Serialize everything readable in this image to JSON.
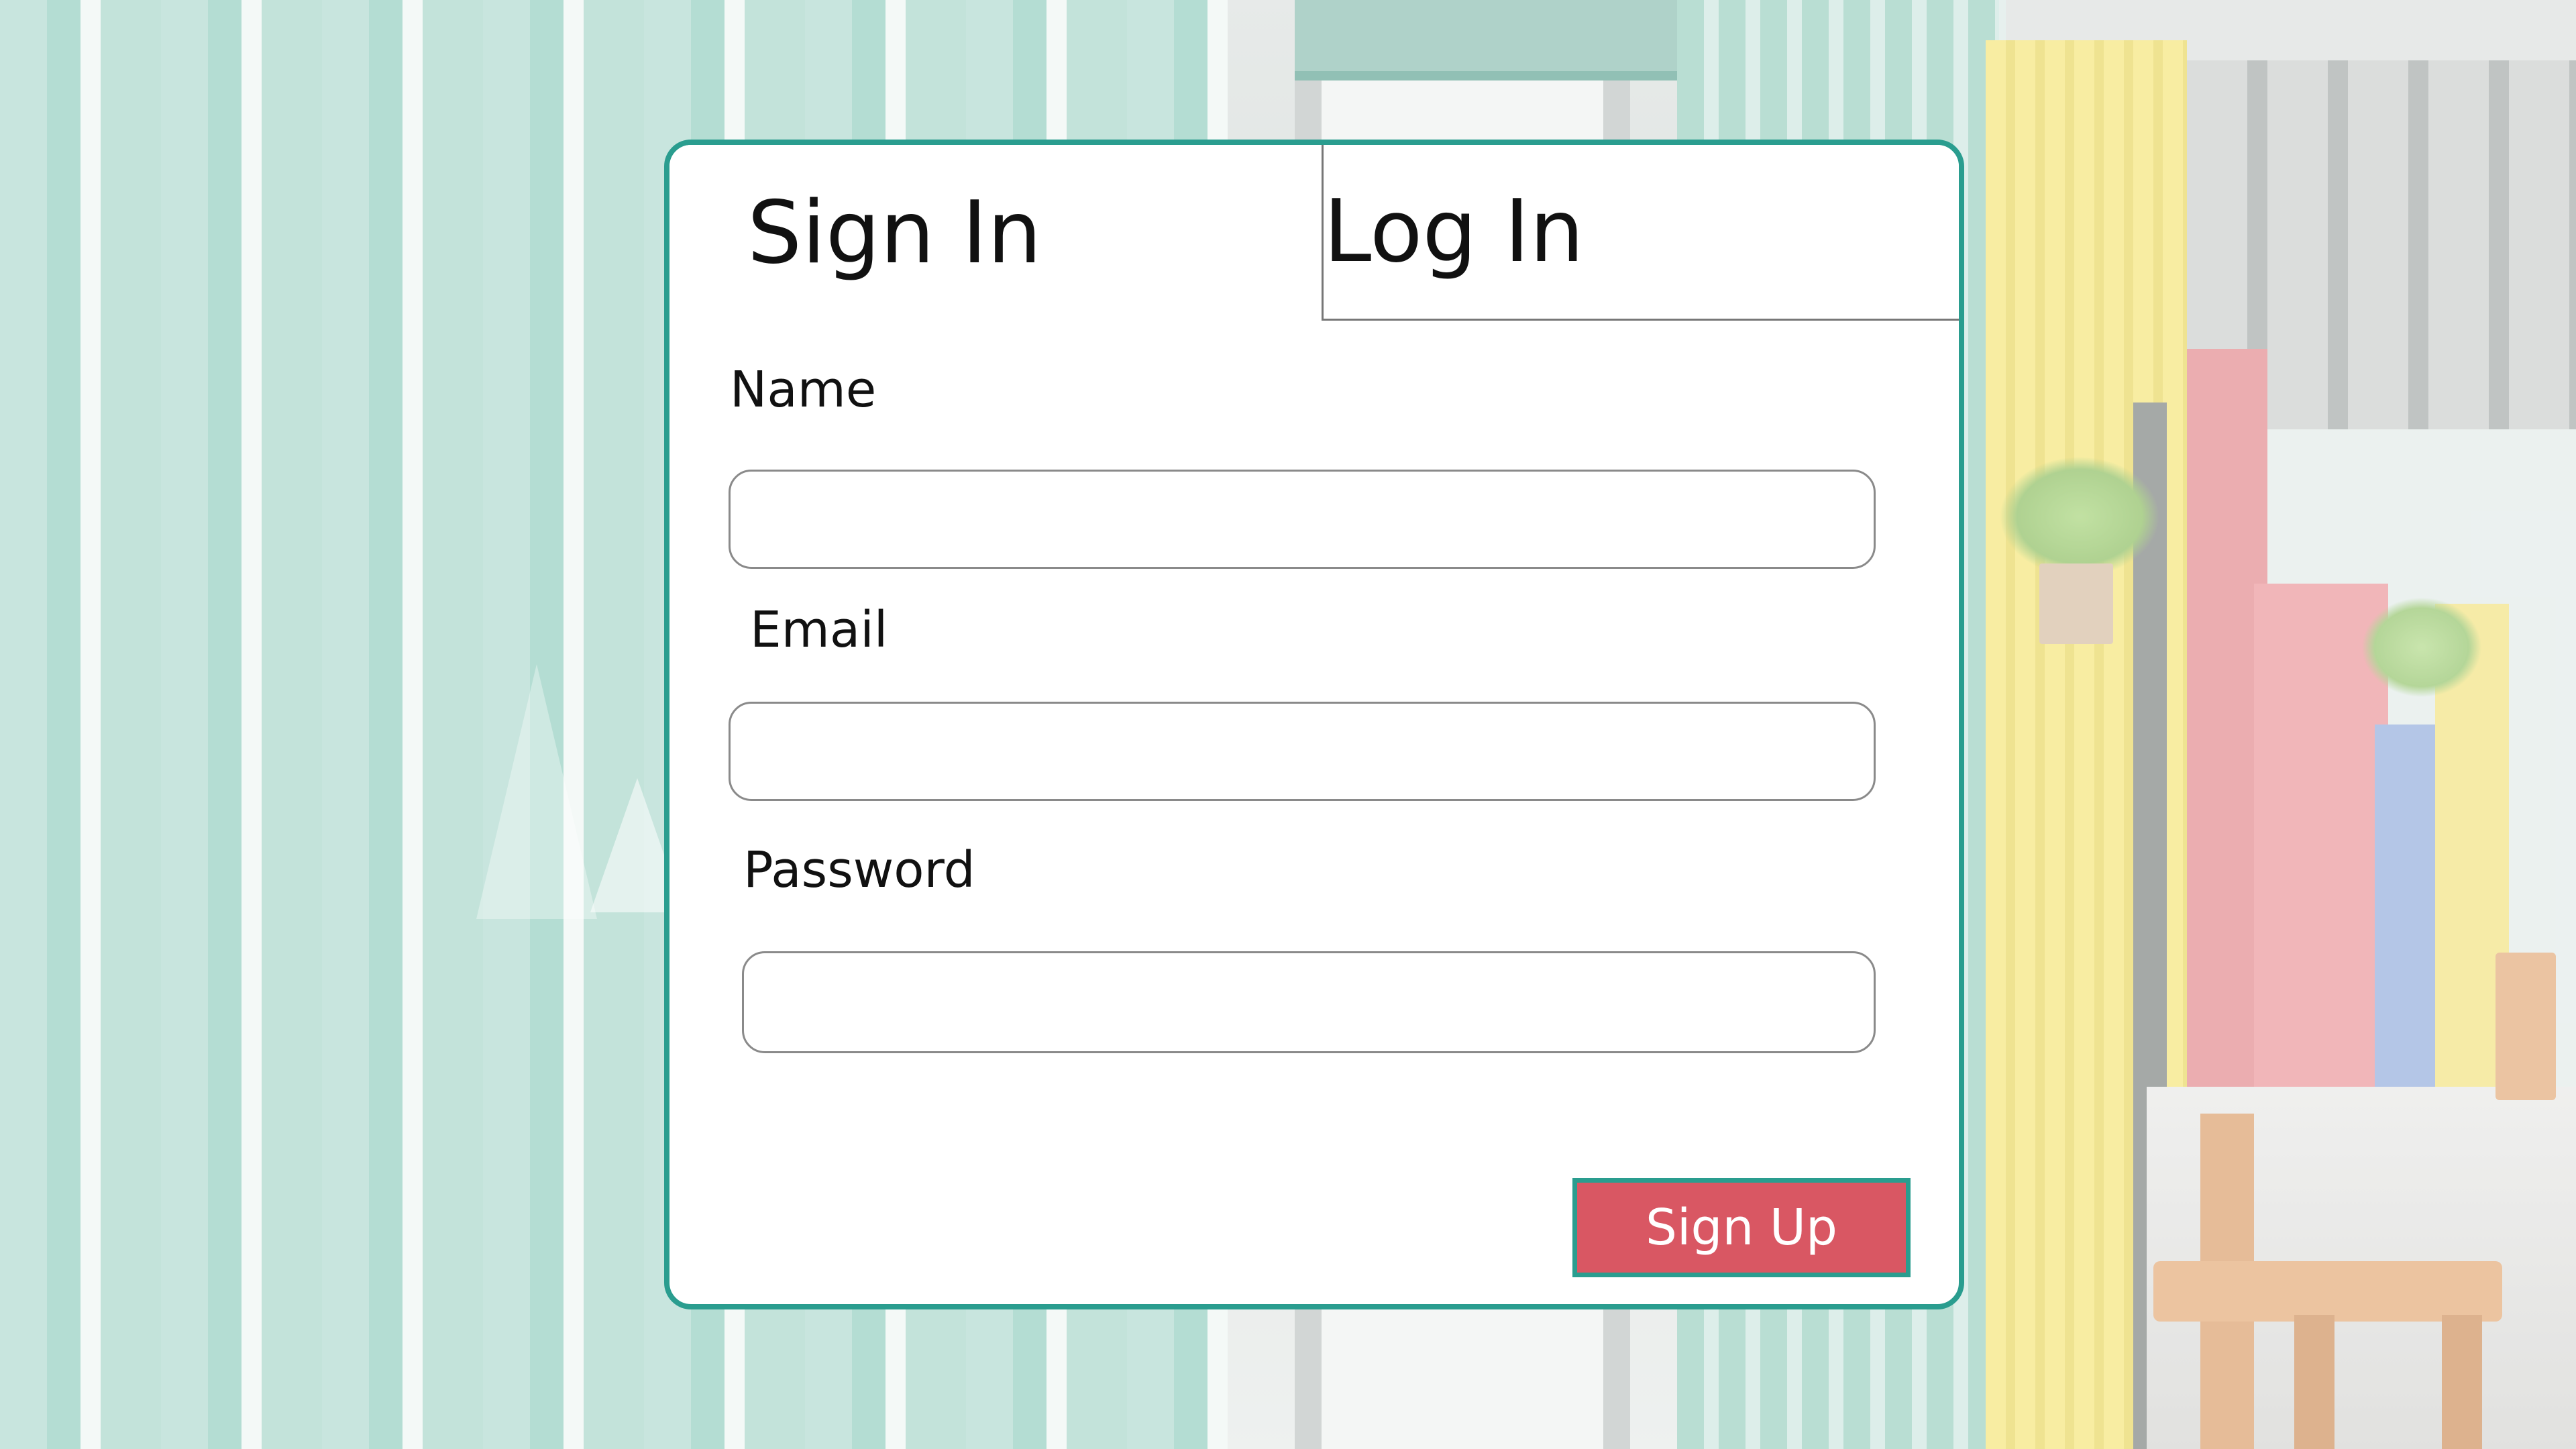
{
  "tabs": {
    "sign_in": "Sign In",
    "log_in": "Log In"
  },
  "form": {
    "name_label": "Name",
    "name_value": "",
    "email_label": "Email",
    "email_value": "",
    "password_label": "Password",
    "password_value": "",
    "submit_label": "Sign Up"
  },
  "colors": {
    "accent": "#2a9d8f",
    "button": "#d95763",
    "button_text": "#ffffff"
  }
}
